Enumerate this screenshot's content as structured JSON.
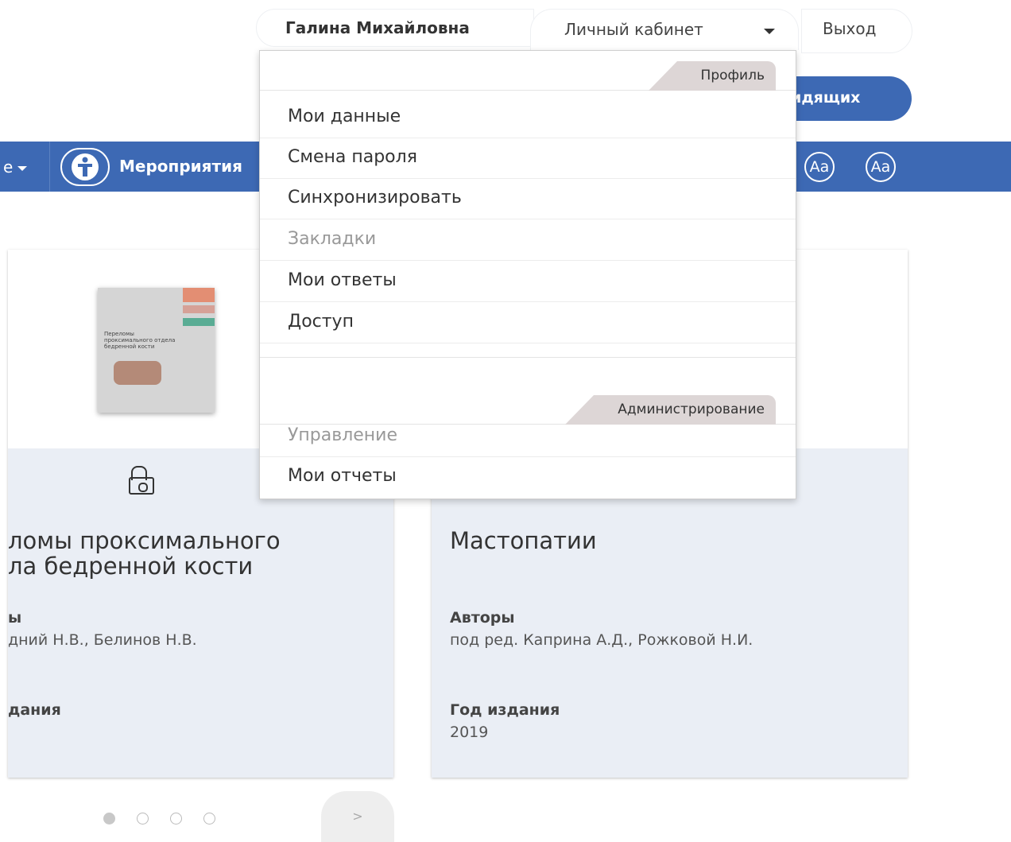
{
  "userbar": {
    "user_name": "Галина Михайловна",
    "cabinet_label": "Личный кабинет",
    "exit_label": "Выход"
  },
  "pill": {
    "label": "идящих"
  },
  "nav": {
    "left_item": "е",
    "events_label": "Мероприятия",
    "font_increase": "Aa",
    "font_decrease": "Aa"
  },
  "dropdown": {
    "profile_header": "Профиль",
    "profile_items": [
      {
        "label": "Мои данные",
        "enabled": true
      },
      {
        "label": "Смена пароля",
        "enabled": true
      },
      {
        "label": "Синхронизировать",
        "enabled": true
      },
      {
        "label": "Закладки",
        "enabled": false
      },
      {
        "label": "Мои ответы",
        "enabled": true
      },
      {
        "label": "Доступ",
        "enabled": true
      }
    ],
    "admin_header": "Администрирование",
    "admin_items": [
      {
        "label": "Управление",
        "enabled": false
      },
      {
        "label": "Мои отчеты",
        "enabled": true
      }
    ]
  },
  "cards": [
    {
      "cover_title": "Переломы проксимального отдела бедренной кости",
      "title": "ломы проксимального\nла бедренной кости",
      "authors_label": "ы",
      "authors": "дний Н.В., Белинов Н.В.",
      "year_label": "дания"
    },
    {
      "title": "Мастопатии",
      "authors_label": "Авторы",
      "authors": "под ред. Каприна А.Д., Рожковой Н.И.",
      "year_label": "Год издания",
      "year": "2019"
    }
  ],
  "carousel": {
    "next_label": ">",
    "pages": 4,
    "active": 1
  }
}
